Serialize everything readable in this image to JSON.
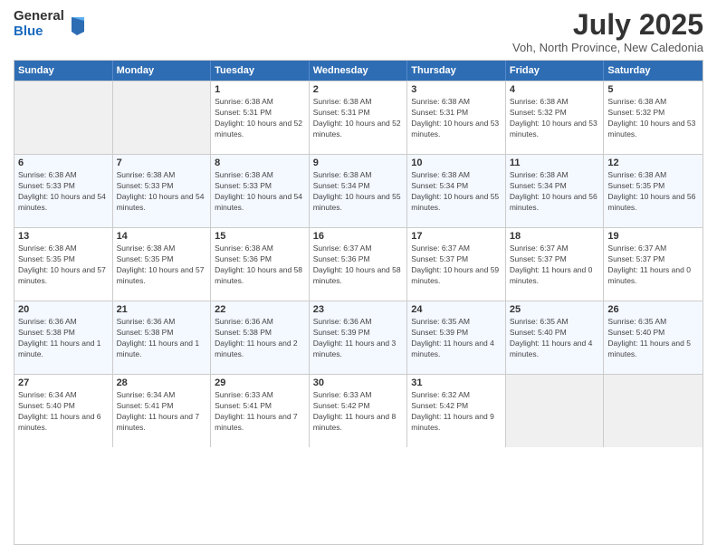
{
  "logo": {
    "general": "General",
    "blue": "Blue"
  },
  "title": "July 2025",
  "subtitle": "Voh, North Province, New Caledonia",
  "days_of_week": [
    "Sunday",
    "Monday",
    "Tuesday",
    "Wednesday",
    "Thursday",
    "Friday",
    "Saturday"
  ],
  "weeks": [
    [
      {
        "day": "",
        "detail": ""
      },
      {
        "day": "",
        "detail": ""
      },
      {
        "day": "1",
        "detail": "Sunrise: 6:38 AM\nSunset: 5:31 PM\nDaylight: 10 hours and 52 minutes."
      },
      {
        "day": "2",
        "detail": "Sunrise: 6:38 AM\nSunset: 5:31 PM\nDaylight: 10 hours and 52 minutes."
      },
      {
        "day": "3",
        "detail": "Sunrise: 6:38 AM\nSunset: 5:31 PM\nDaylight: 10 hours and 53 minutes."
      },
      {
        "day": "4",
        "detail": "Sunrise: 6:38 AM\nSunset: 5:32 PM\nDaylight: 10 hours and 53 minutes."
      },
      {
        "day": "5",
        "detail": "Sunrise: 6:38 AM\nSunset: 5:32 PM\nDaylight: 10 hours and 53 minutes."
      }
    ],
    [
      {
        "day": "6",
        "detail": "Sunrise: 6:38 AM\nSunset: 5:33 PM\nDaylight: 10 hours and 54 minutes."
      },
      {
        "day": "7",
        "detail": "Sunrise: 6:38 AM\nSunset: 5:33 PM\nDaylight: 10 hours and 54 minutes."
      },
      {
        "day": "8",
        "detail": "Sunrise: 6:38 AM\nSunset: 5:33 PM\nDaylight: 10 hours and 54 minutes."
      },
      {
        "day": "9",
        "detail": "Sunrise: 6:38 AM\nSunset: 5:34 PM\nDaylight: 10 hours and 55 minutes."
      },
      {
        "day": "10",
        "detail": "Sunrise: 6:38 AM\nSunset: 5:34 PM\nDaylight: 10 hours and 55 minutes."
      },
      {
        "day": "11",
        "detail": "Sunrise: 6:38 AM\nSunset: 5:34 PM\nDaylight: 10 hours and 56 minutes."
      },
      {
        "day": "12",
        "detail": "Sunrise: 6:38 AM\nSunset: 5:35 PM\nDaylight: 10 hours and 56 minutes."
      }
    ],
    [
      {
        "day": "13",
        "detail": "Sunrise: 6:38 AM\nSunset: 5:35 PM\nDaylight: 10 hours and 57 minutes."
      },
      {
        "day": "14",
        "detail": "Sunrise: 6:38 AM\nSunset: 5:35 PM\nDaylight: 10 hours and 57 minutes."
      },
      {
        "day": "15",
        "detail": "Sunrise: 6:38 AM\nSunset: 5:36 PM\nDaylight: 10 hours and 58 minutes."
      },
      {
        "day": "16",
        "detail": "Sunrise: 6:37 AM\nSunset: 5:36 PM\nDaylight: 10 hours and 58 minutes."
      },
      {
        "day": "17",
        "detail": "Sunrise: 6:37 AM\nSunset: 5:37 PM\nDaylight: 10 hours and 59 minutes."
      },
      {
        "day": "18",
        "detail": "Sunrise: 6:37 AM\nSunset: 5:37 PM\nDaylight: 11 hours and 0 minutes."
      },
      {
        "day": "19",
        "detail": "Sunrise: 6:37 AM\nSunset: 5:37 PM\nDaylight: 11 hours and 0 minutes."
      }
    ],
    [
      {
        "day": "20",
        "detail": "Sunrise: 6:36 AM\nSunset: 5:38 PM\nDaylight: 11 hours and 1 minute."
      },
      {
        "day": "21",
        "detail": "Sunrise: 6:36 AM\nSunset: 5:38 PM\nDaylight: 11 hours and 1 minute."
      },
      {
        "day": "22",
        "detail": "Sunrise: 6:36 AM\nSunset: 5:38 PM\nDaylight: 11 hours and 2 minutes."
      },
      {
        "day": "23",
        "detail": "Sunrise: 6:36 AM\nSunset: 5:39 PM\nDaylight: 11 hours and 3 minutes."
      },
      {
        "day": "24",
        "detail": "Sunrise: 6:35 AM\nSunset: 5:39 PM\nDaylight: 11 hours and 4 minutes."
      },
      {
        "day": "25",
        "detail": "Sunrise: 6:35 AM\nSunset: 5:40 PM\nDaylight: 11 hours and 4 minutes."
      },
      {
        "day": "26",
        "detail": "Sunrise: 6:35 AM\nSunset: 5:40 PM\nDaylight: 11 hours and 5 minutes."
      }
    ],
    [
      {
        "day": "27",
        "detail": "Sunrise: 6:34 AM\nSunset: 5:40 PM\nDaylight: 11 hours and 6 minutes."
      },
      {
        "day": "28",
        "detail": "Sunrise: 6:34 AM\nSunset: 5:41 PM\nDaylight: 11 hours and 7 minutes."
      },
      {
        "day": "29",
        "detail": "Sunrise: 6:33 AM\nSunset: 5:41 PM\nDaylight: 11 hours and 7 minutes."
      },
      {
        "day": "30",
        "detail": "Sunrise: 6:33 AM\nSunset: 5:42 PM\nDaylight: 11 hours and 8 minutes."
      },
      {
        "day": "31",
        "detail": "Sunrise: 6:32 AM\nSunset: 5:42 PM\nDaylight: 11 hours and 9 minutes."
      },
      {
        "day": "",
        "detail": ""
      },
      {
        "day": "",
        "detail": ""
      }
    ]
  ]
}
